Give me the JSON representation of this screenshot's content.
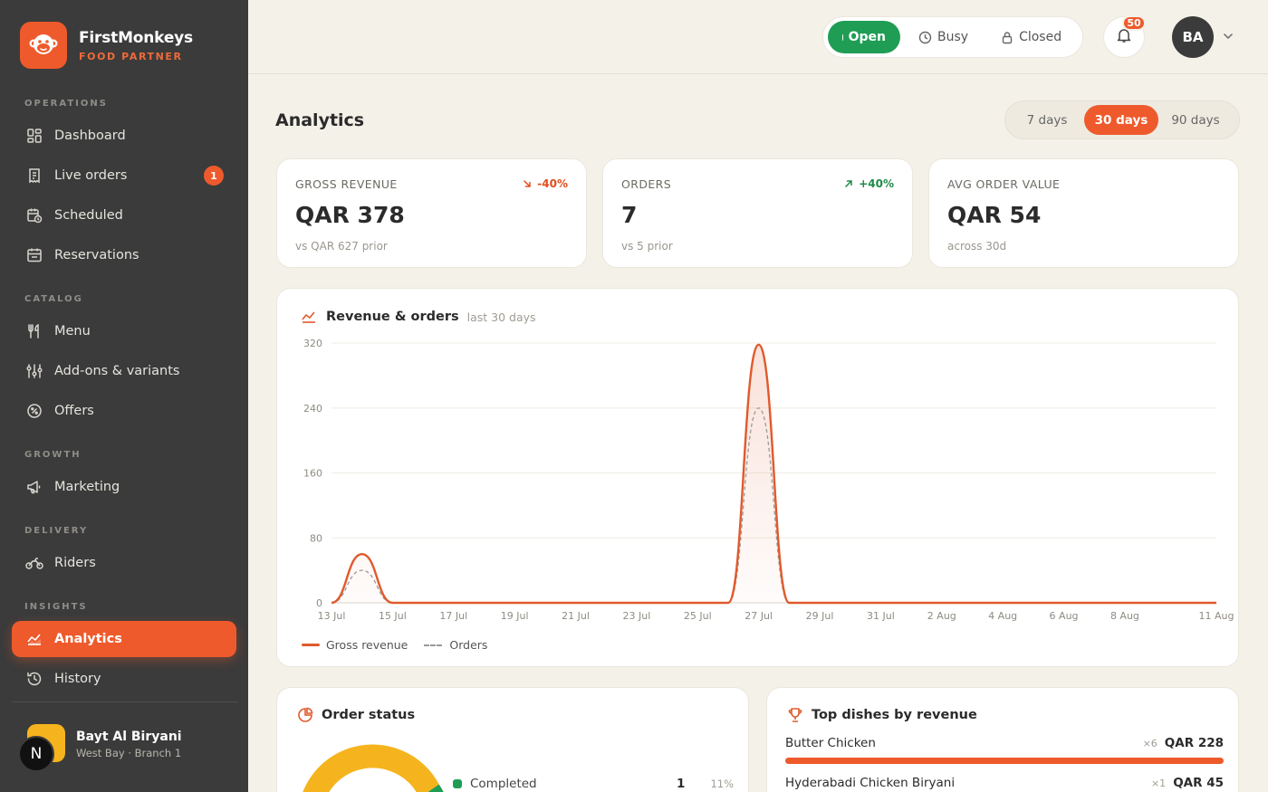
{
  "brand": {
    "name": "FirstMonkeys",
    "subtitle": "FOOD PARTNER"
  },
  "nav": {
    "sections": {
      "operations": "OPERATIONS",
      "catalog": "CATALOG",
      "growth": "GROWTH",
      "delivery": "DELIVERY",
      "insights": "INSIGHTS"
    },
    "items": {
      "dashboard": "Dashboard",
      "live_orders": "Live orders",
      "live_orders_badge": "1",
      "scheduled": "Scheduled",
      "reservations": "Reservations",
      "menu": "Menu",
      "addons": "Add-ons & variants",
      "offers": "Offers",
      "marketing": "Marketing",
      "riders": "Riders",
      "analytics": "Analytics",
      "history": "History"
    },
    "active": "analytics"
  },
  "branch": {
    "name": "Bayt Al Biryani",
    "location": "West Bay · Branch 1",
    "avatar_letter": "N"
  },
  "topbar": {
    "status": {
      "open": "Open",
      "busy": "Busy",
      "closed": "Closed",
      "selected": "open"
    },
    "notifications": "50",
    "user_initials": "BA"
  },
  "page": {
    "title": "Analytics",
    "ranges": [
      "7 days",
      "30 days",
      "90 days"
    ],
    "active_range": "30 days"
  },
  "kpis": [
    {
      "label": "GROSS REVENUE",
      "value": "QAR 378",
      "sub": "vs QAR 627 prior",
      "delta": "-40%",
      "direction": "down"
    },
    {
      "label": "ORDERS",
      "value": "7",
      "sub": "vs 5 prior",
      "delta": "+40%",
      "direction": "up"
    },
    {
      "label": "AVG ORDER VALUE",
      "value": "QAR 54",
      "sub": "across 30d",
      "delta": "",
      "direction": ""
    }
  ],
  "revenue_chart": {
    "title": "Revenue & orders",
    "subtitle": "last 30 days"
  },
  "chart_data": {
    "type": "area",
    "x": [
      "13 Jul",
      "14 Jul",
      "15 Jul",
      "16 Jul",
      "17 Jul",
      "18 Jul",
      "19 Jul",
      "20 Jul",
      "21 Jul",
      "22 Jul",
      "23 Jul",
      "24 Jul",
      "25 Jul",
      "26 Jul",
      "27 Jul",
      "28 Jul",
      "29 Jul",
      "30 Jul",
      "31 Jul",
      "1 Aug",
      "2 Aug",
      "3 Aug",
      "4 Aug",
      "5 Aug",
      "6 Aug",
      "7 Aug",
      "8 Aug",
      "9 Aug",
      "10 Aug",
      "11 Aug"
    ],
    "xticks": [
      "13 Jul",
      "15 Jul",
      "17 Jul",
      "19 Jul",
      "21 Jul",
      "23 Jul",
      "25 Jul",
      "27 Jul",
      "29 Jul",
      "31 Jul",
      "2 Aug",
      "4 Aug",
      "6 Aug",
      "8 Aug",
      "11 Aug"
    ],
    "series": [
      {
        "name": "Gross revenue",
        "values": [
          0,
          60,
          0,
          0,
          0,
          0,
          0,
          0,
          0,
          0,
          0,
          0,
          0,
          0,
          318,
          0,
          0,
          0,
          0,
          0,
          0,
          0,
          0,
          0,
          0,
          0,
          0,
          0,
          0,
          0
        ],
        "color": "#e05a2c",
        "style": "solid"
      },
      {
        "name": "Orders",
        "values": [
          0,
          40,
          0,
          0,
          0,
          0,
          0,
          0,
          0,
          0,
          0,
          0,
          0,
          0,
          240,
          0,
          0,
          0,
          0,
          0,
          0,
          0,
          0,
          0,
          0,
          0,
          0,
          0,
          0,
          0
        ],
        "color": "#9a9a9a",
        "style": "dashed"
      }
    ],
    "yticks": [
      0,
      80,
      160,
      240,
      320
    ],
    "ylim": [
      0,
      320
    ],
    "grid": true,
    "legend": "bottom-left"
  },
  "order_status": {
    "title": "Order status",
    "items": [
      {
        "label": "Completed",
        "count": "1",
        "pct": "11%",
        "color": "#1f9d55"
      }
    ]
  },
  "top_dishes": {
    "title": "Top dishes by revenue",
    "items": [
      {
        "name": "Butter Chicken",
        "qty": "×6",
        "revenue": "QAR 228",
        "share": 1.0
      },
      {
        "name": "Hyderabadi Chicken Biryani",
        "qty": "×1",
        "revenue": "QAR 45",
        "share": 0.2
      }
    ]
  }
}
